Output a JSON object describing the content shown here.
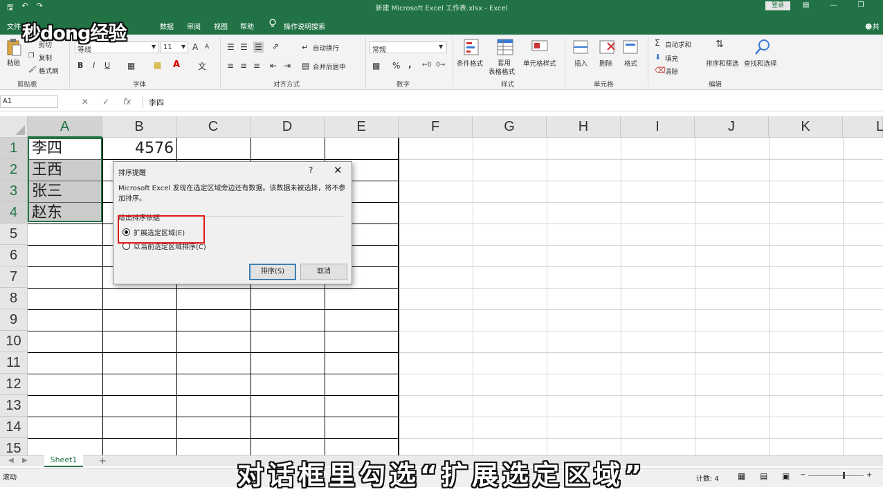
{
  "titlebar": {
    "doc_title": "新建 Microsoft Excel 工作表.xlsx - Excel",
    "login_label": "登录"
  },
  "tabs": {
    "items": [
      "文件",
      "开始",
      "页面",
      "数据",
      "审阅",
      "视图",
      "帮助"
    ],
    "tell_me": "操作说明搜索",
    "share": "共"
  },
  "watermark": {
    "logo_text": "秒dong经验"
  },
  "ribbon": {
    "clipboard": {
      "paste": "粘贴",
      "cut": "剪切",
      "copy": "复制",
      "format_painter": "格式刷",
      "label": "剪贴板"
    },
    "font": {
      "name": "等线",
      "size": "11",
      "grow": "A",
      "shrink": "A",
      "bold": "B",
      "italic": "I",
      "underline": "U",
      "label": "字体"
    },
    "alignment": {
      "wrap": "自动换行",
      "merge": "合并后居中",
      "label": "对齐方式"
    },
    "number": {
      "format": "常规",
      "percent": "%",
      "comma": ",",
      "label": "数字"
    },
    "styles": {
      "conditional": "条件格式",
      "table": "套用",
      "table2": "表格格式",
      "cell_styles": "单元格样式",
      "label": "样式"
    },
    "cells": {
      "insert": "插入",
      "delete": "删除",
      "format": "格式",
      "label": "单元格"
    },
    "editing": {
      "autosum": "自动求和",
      "fill": "填充",
      "clear": "清除",
      "sort_filter": "排序和筛选",
      "find_select": "查找和选择",
      "label": "编辑"
    }
  },
  "formula_bar": {
    "name_box": "A1",
    "cancel": "✕",
    "enter": "✓",
    "fx": "fx",
    "content": "李四"
  },
  "grid": {
    "columns": [
      "A",
      "B",
      "C",
      "D",
      "E",
      "F",
      "G",
      "H",
      "I",
      "J",
      "K",
      "L"
    ],
    "rows": [
      "1",
      "2",
      "3",
      "4",
      "5",
      "6",
      "7",
      "8",
      "9",
      "10",
      "11",
      "12",
      "13",
      "14",
      "15"
    ],
    "cells": {
      "A1": "李四",
      "A2": "王西",
      "A3": "张三",
      "A4": "赵东",
      "B1": "4576"
    }
  },
  "dialog": {
    "title": "排序提醒",
    "help": "?",
    "close": "✕",
    "message": "Microsoft Excel 发现在选定区域旁边还有数据。该数据未被选择，将不参加排序。",
    "subtitle": "给出排序依据",
    "options": [
      {
        "label": "扩展选定区域(E)",
        "selected": true
      },
      {
        "label": "以当前选定区域排序(C)",
        "selected": false
      }
    ],
    "ok_label": "排序(S)",
    "cancel_label": "取消"
  },
  "sheets": {
    "active": "Sheet1",
    "add": "+"
  },
  "status": {
    "mode": "滚动",
    "count": "计数: 4",
    "zoom_minus": "−",
    "zoom_plus": "+"
  },
  "caption": "对话框里勾选“扩展选定区域”",
  "colors": {
    "excel_green": "#217346",
    "highlight_red": "#e01a1a"
  }
}
